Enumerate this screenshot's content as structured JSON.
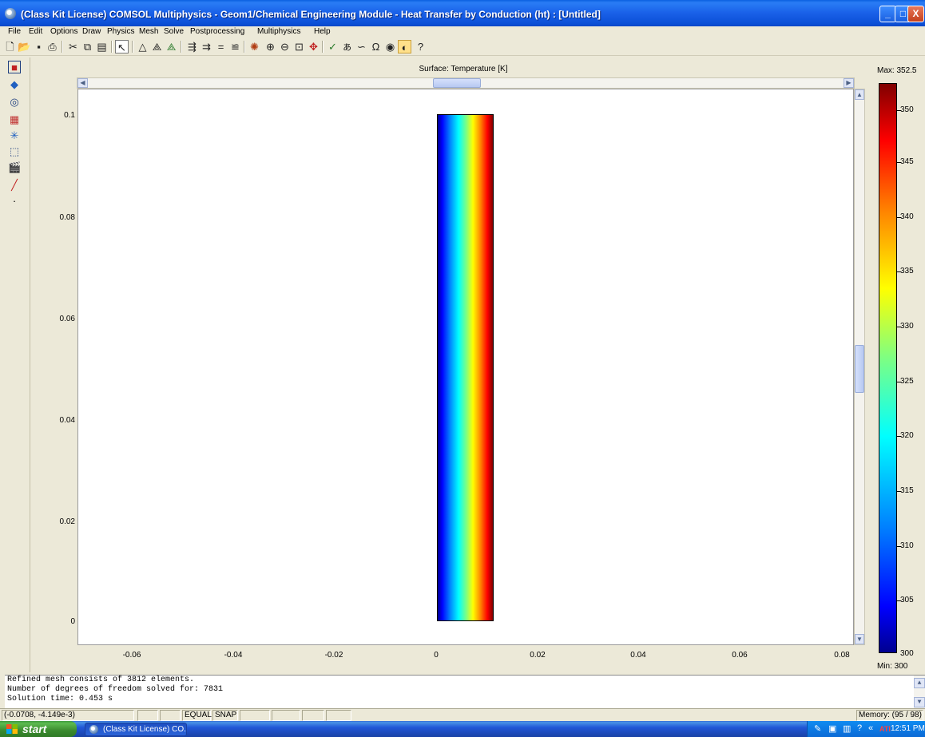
{
  "window": {
    "title": "(Class Kit License) COMSOL Multiphysics - Geom1/Chemical Engineering Module - Heat Transfer by Conduction (ht) : [Untitled]",
    "minimize": "_",
    "maximize": "□",
    "close": "X"
  },
  "menu": [
    "File",
    "Edit",
    "Options",
    "Draw",
    "Physics",
    "Mesh",
    "Solve",
    "Postprocessing",
    "Multiphysics",
    "Help"
  ],
  "plot": {
    "title": "Surface: Temperature [K]",
    "y_ticks": [
      "0.1",
      "0.08",
      "0.06",
      "0.04",
      "0.02",
      "0"
    ],
    "x_ticks": [
      "-0.06",
      "-0.04",
      "-0.02",
      "0",
      "0.02",
      "0.04",
      "0.06",
      "0.08"
    ],
    "colorbar": {
      "max_label": "Max: 352.5",
      "min_label": "Min: 300",
      "ticks": [
        "350",
        "345",
        "340",
        "335",
        "330",
        "325",
        "320",
        "315",
        "310",
        "305",
        "300"
      ]
    }
  },
  "log": {
    "lines": [
      "Refined mesh consists of 3812 elements.",
      "Number of degrees of freedom solved for: 7831",
      "Solution time: 0.453 s"
    ]
  },
  "status": {
    "coords": "(-0.0708, -4.149e-3)",
    "equal": "EQUAL",
    "snap": "SNAP",
    "memory": "Memory: (95 / 98)"
  },
  "taskbar": {
    "start": "start",
    "task": "(Class Kit License) CO...",
    "clock": "12:51 PM"
  }
}
